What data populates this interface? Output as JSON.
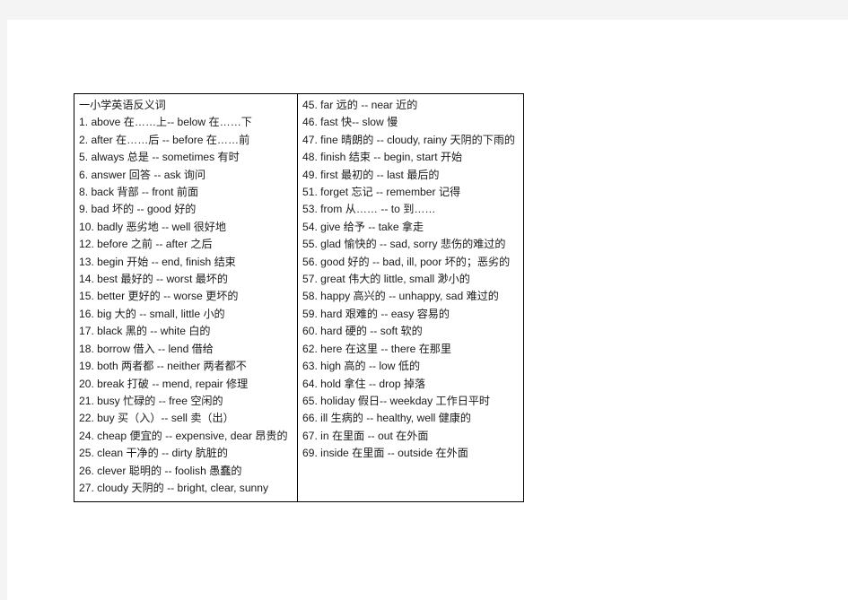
{
  "document": {
    "heading": "一小学英语反义词",
    "columns": [
      {
        "id": "left",
        "entries": [
          "1. above   在……上-- below   在……下",
          "2. after 在……后 -- before   在……前",
          "5. always   总是 -- sometimes  有时",
          "6. answer   回答 -- ask   询问",
          "8. back 背部 -- front     前面",
          "9. bad   坏的 -- good   好的",
          "10. badly  恶劣地 -- well    很好地",
          "12. before 之前 -- after 之后",
          "13. begin   开始 -- end, finish   结束",
          "14. best   最好的 -- worst   最坏的",
          "15. better  更好的 -- worse   更坏的",
          "16. big   大的 -- small, little  小的",
          "17. black   黑的 -- white   白的",
          "18. borrow   借入 -- lend  借给",
          "19. both   两者都 -- neither   两者都不",
          "20. break   打破 -- mend, repair   修理",
          "21. busy   忙碌的 -- free    空闲的",
          "22. buy   买（入）-- sell   卖（出）",
          "24. cheap   便宜的 -- expensive, dear   昂贵的",
          "25. clean   干净的 -- dirty   肮脏的",
          "26. clever  聪明的 -- foolish   愚蠢的",
          "27. cloudy   天阴的 -- bright, clear, sunny"
        ]
      },
      {
        "id": "right",
        "entries": [
          "45. far    远的 -- near  近的",
          "46. fast  快-- slow  慢",
          "47. fine   晴朗的 -- cloudy, rainy    天阴的下雨的",
          "48. finish   结束 --  begin, start   开始",
          "49. first   最初的 --  last  最后的",
          "51. forget  忘记 -- remember   记得",
          "53. from   从…… -- to  到……",
          "54. give   给予 -- take   拿走",
          "55. glad   愉快的 -- sad, sorry 悲伤的难过的",
          "56. good   好的 -- bad, ill, poor    坏的；恶劣的",
          "57. great   伟大的   little, small  渺小的",
          "58. happy   高兴的 -- unhappy, sad  难过的",
          "59. hard   艰难的 -- easy    容易的",
          "60. hard   硬的 --  soft  软的",
          "62. here   在这里 --  there      在那里",
          "63. high   高的 -- low   低的",
          "64. hold   拿住 --  drop    掉落",
          "65. holiday  假日-- weekday   工作日平时",
          "66. ill    生病的 -- healthy, well  健康的",
          "67. in   在里面 -- out   在外面",
          "69. inside   在里面 -- outside    在外面"
        ]
      }
    ]
  }
}
